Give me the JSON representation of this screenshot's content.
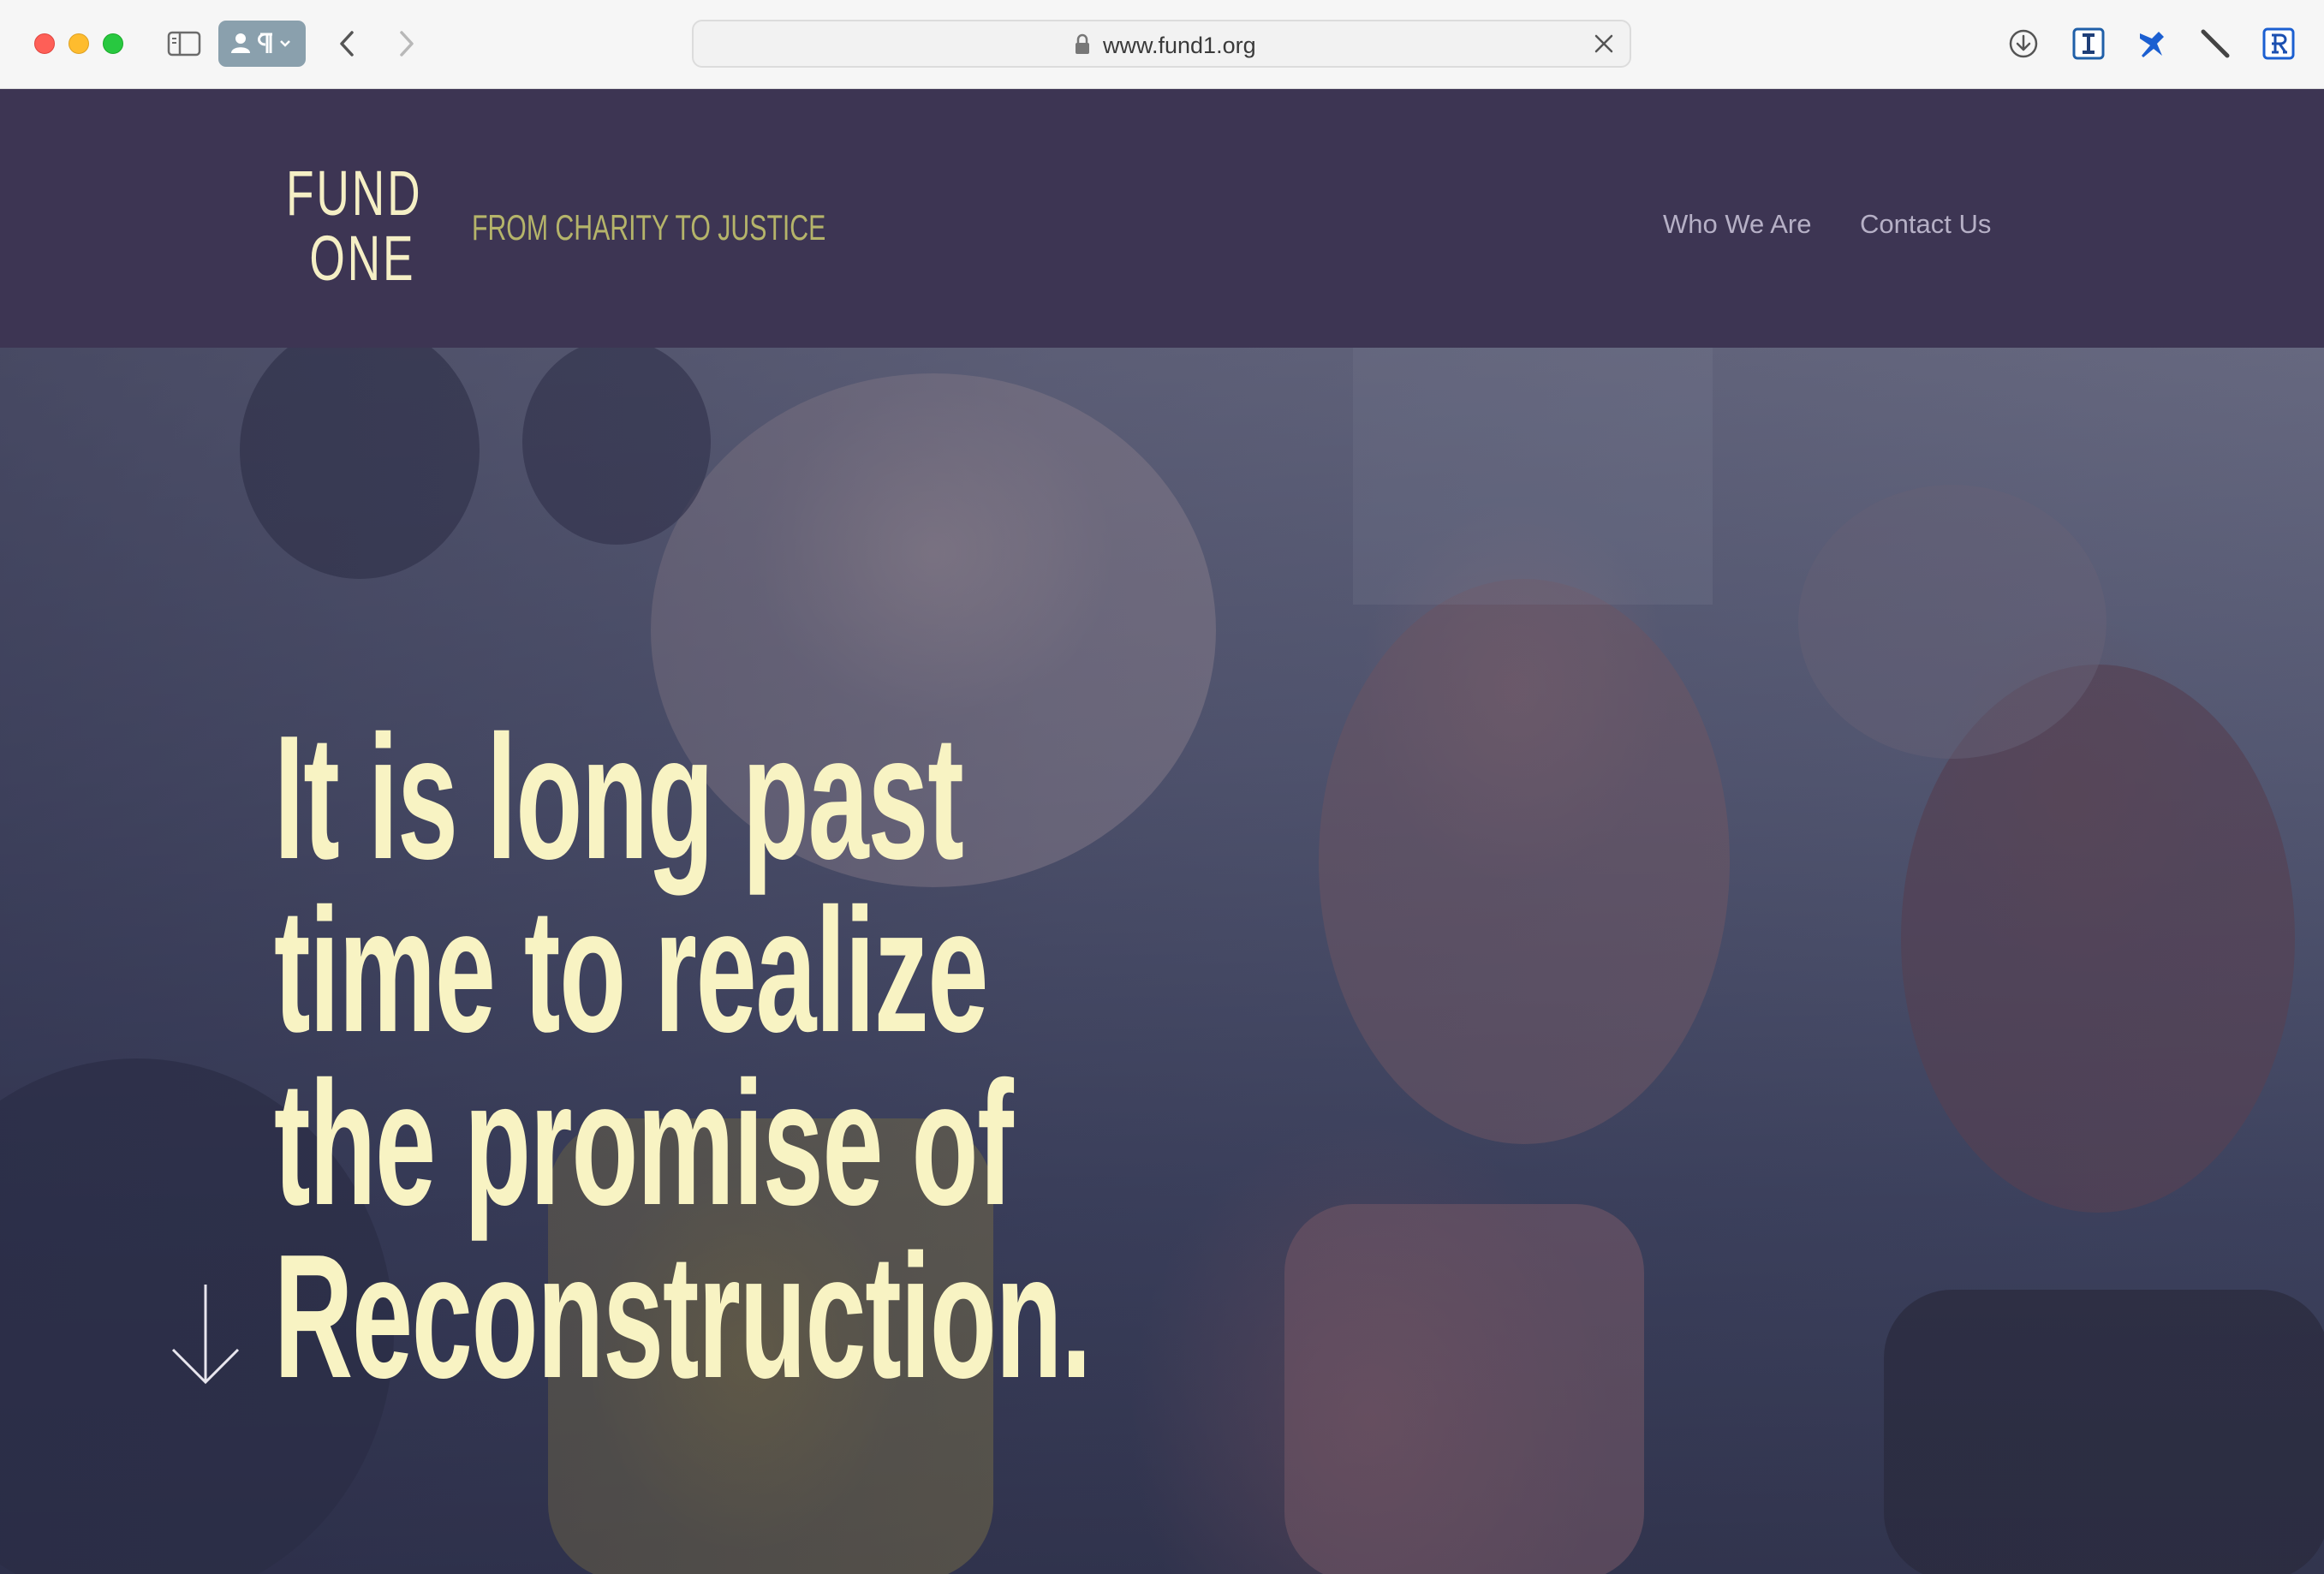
{
  "browser": {
    "url": "www.fund1.org"
  },
  "header": {
    "logo_line1": "FUND",
    "logo_line2": "ONE",
    "tagline": "FROM CHARITY TO JUSTICE",
    "nav": [
      {
        "label": "Who We Are"
      },
      {
        "label": "Contact Us"
      }
    ]
  },
  "hero": {
    "lines": [
      "It is long past",
      "time to realize",
      "the promise of",
      "Reconstruction."
    ]
  },
  "colors": {
    "header_bg": "#3d3553",
    "logo": "#f5efc5",
    "tagline": "#b5b46a",
    "nav": "#b6b0c6",
    "headline": "#f8f3c3"
  },
  "icons": {
    "toolbar": [
      "download-icon",
      "text-cursor-extension-icon",
      "pin-extension-icon",
      "pen-extension-icon",
      "r-extension-icon"
    ]
  }
}
